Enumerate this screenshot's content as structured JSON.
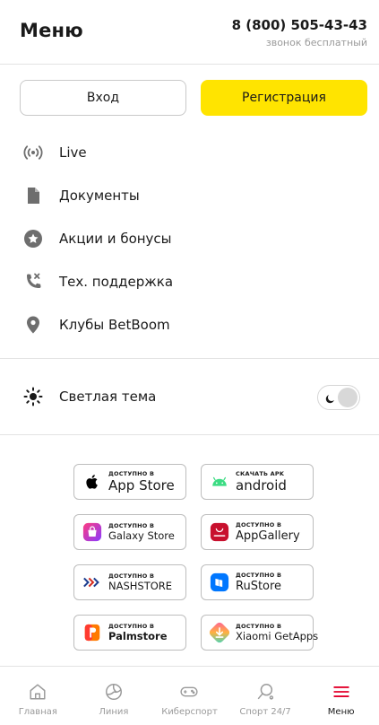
{
  "header": {
    "title": "Меню",
    "phone": "8 (800) 505-43-43",
    "phone_note": "звонок бесплатный"
  },
  "auth": {
    "login_label": "Вход",
    "register_label": "Регистрация"
  },
  "menu": {
    "items": [
      {
        "label": "Live",
        "icon": "live-broadcast-icon"
      },
      {
        "label": "Документы",
        "icon": "document-icon"
      },
      {
        "label": "Акции и бонусы",
        "icon": "star-badge-icon"
      },
      {
        "label": "Тех. поддержка",
        "icon": "phone-support-icon"
      },
      {
        "label": "Клубы BetBoom",
        "icon": "location-pin-icon"
      }
    ]
  },
  "theme": {
    "label": "Светлая тема",
    "dark_mode_enabled": false
  },
  "stores": [
    {
      "small": "ДОСТУПНО В",
      "big": "App Store",
      "icon": "apple-icon"
    },
    {
      "small": "СКАЧАТЬ APK",
      "big": "android",
      "icon": "android-icon"
    },
    {
      "small": "ДОСТУПНО В",
      "big": "Galaxy Store",
      "icon": "galaxy-store-icon"
    },
    {
      "small": "ДОСТУПНО В",
      "big": "AppGallery",
      "icon": "huawei-appgallery-icon"
    },
    {
      "small": "ДОСТУПНО В",
      "big": "NASHSTORE",
      "icon": "nashstore-icon"
    },
    {
      "small": "ДОСТУПНО В",
      "big": "RuStore",
      "icon": "rustore-icon"
    },
    {
      "small": "ДОСТУПНО В",
      "big": "Palmstore",
      "icon": "palmstore-icon"
    },
    {
      "small": "ДОСТУПНО В",
      "big": "Xiaomi GetApps",
      "icon": "xiaomi-getapps-icon"
    }
  ],
  "nav": {
    "items": [
      {
        "label": "Главная",
        "icon": "home-icon"
      },
      {
        "label": "Линия",
        "icon": "volleyball-icon"
      },
      {
        "label": "Киберспорт",
        "icon": "gamepad-icon"
      },
      {
        "label": "Спорт 24/7",
        "icon": "ping-pong-icon"
      },
      {
        "label": "Меню",
        "icon": "hamburger-menu-icon"
      }
    ],
    "active": "Меню"
  },
  "colors": {
    "accent_yellow": "#ffe400",
    "active_red": "#e3002b",
    "icon_gray": "#6e6e6e"
  }
}
